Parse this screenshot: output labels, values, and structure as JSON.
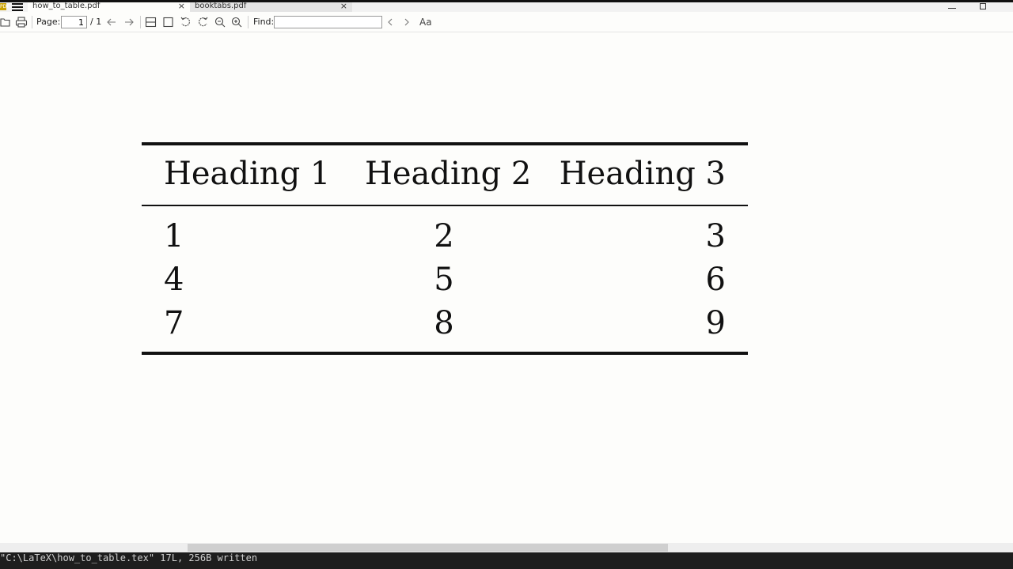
{
  "tabs": [
    {
      "title": "how_to_table.pdf",
      "active": true
    },
    {
      "title": "booktabs.pdf",
      "active": false
    }
  ],
  "app_icon_text": "PDF",
  "toolbar": {
    "page_label": "Page:",
    "page_value": "1",
    "page_total": "/ 1",
    "find_label": "Find:",
    "find_value": "",
    "font_button": "Aa"
  },
  "document": {
    "table": {
      "headers": [
        "Heading 1",
        "Heading 2",
        "Heading 3"
      ],
      "rows": [
        [
          "1",
          "2",
          "3"
        ],
        [
          "4",
          "5",
          "6"
        ],
        [
          "7",
          "8",
          "9"
        ]
      ]
    }
  },
  "statusline": {
    "text": "\"C:\\LaTeX\\how_to_table.tex\" 17L, 256B written"
  },
  "colors": {
    "background": "#fdfdfb",
    "rules": "#111111",
    "statusbar": "#1e1e1e"
  }
}
